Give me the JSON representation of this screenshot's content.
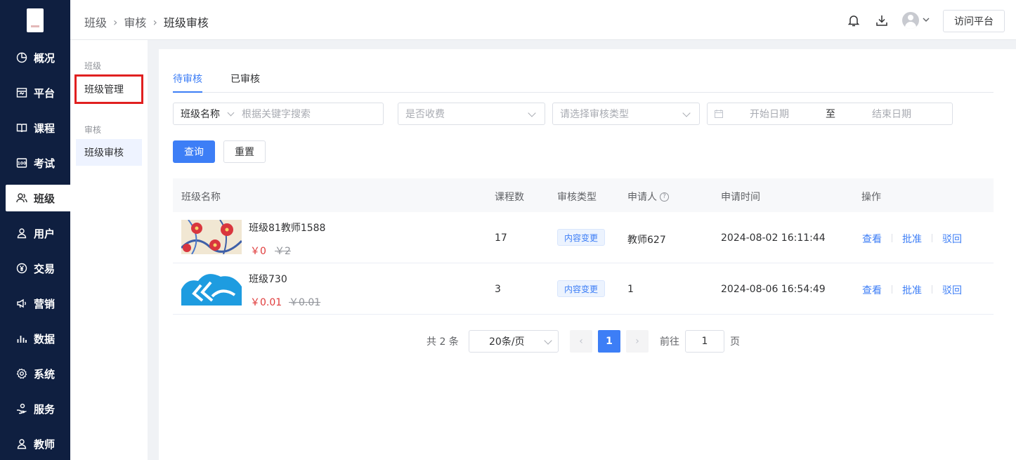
{
  "nav": {
    "items": [
      {
        "label": "概况",
        "icon": "pie-chart-icon"
      },
      {
        "label": "平台",
        "icon": "store-icon"
      },
      {
        "label": "课程",
        "icon": "book-icon"
      },
      {
        "label": "考试",
        "icon": "exam-icon"
      },
      {
        "label": "班级",
        "icon": "users-icon"
      },
      {
        "label": "用户",
        "icon": "user-icon"
      },
      {
        "label": "交易",
        "icon": "yuan-icon"
      },
      {
        "label": "营销",
        "icon": "megaphone-icon"
      },
      {
        "label": "数据",
        "icon": "bar-chart-icon"
      },
      {
        "label": "系统",
        "icon": "gear-icon"
      },
      {
        "label": "服务",
        "icon": "hand-icon"
      },
      {
        "label": "教师",
        "icon": "teacher-icon"
      }
    ],
    "active_index": 4
  },
  "header": {
    "breadcrumb": [
      "班级",
      "审核",
      "班级审核"
    ],
    "visit_label": "访问平台"
  },
  "subnav": {
    "group1": "班级",
    "item1": "班级管理",
    "group2": "审核",
    "item2": "班级审核"
  },
  "tabs": [
    "待审核",
    "已审核"
  ],
  "filters": {
    "name_select": "班级名称",
    "keyword_placeholder": "根据关键字搜索",
    "fee_placeholder": "是否收费",
    "type_placeholder": "请选择审核类型",
    "start_placeholder": "开始日期",
    "range_sep": "至",
    "end_placeholder": "结束日期",
    "query_label": "查询",
    "reset_label": "重置"
  },
  "table": {
    "headers": [
      "班级名称",
      "课程数",
      "审核类型",
      "申请人",
      "申请时间",
      "操作"
    ],
    "rows": [
      {
        "name": "班级81教师1588",
        "price": "￥0",
        "old_price": "￥2",
        "courses": "17",
        "type": "内容变更",
        "applicant": "教师627",
        "time": "2024-08-02 16:11:44"
      },
      {
        "name": "班级730",
        "price": "￥0.01",
        "old_price": "￥0.01",
        "courses": "3",
        "type": "内容变更",
        "applicant": "1",
        "time": "2024-08-06 16:54:49"
      }
    ],
    "actions": [
      "查看",
      "批准",
      "驳回"
    ]
  },
  "pagination": {
    "total": "共 2 条",
    "page_size": "20条/页",
    "current_page": "1",
    "goto_label": "前往",
    "goto_value": "1",
    "page_suffix": "页"
  },
  "colors": {
    "nav_bg": "#0f1f40",
    "accent": "#3d7ef6",
    "price": "#e03c3c",
    "highlight_box": "#e02020"
  }
}
